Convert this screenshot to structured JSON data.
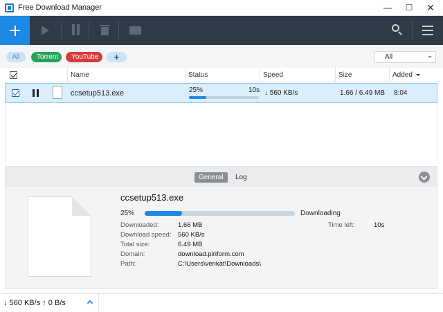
{
  "window": {
    "title": "Free Download Manager",
    "minimize": "—",
    "maximize": "☐",
    "close": "✕"
  },
  "toolbar": {
    "icons": [
      "add-icon",
      "play-icon",
      "pause-icon",
      "trash-icon",
      "move-icon",
      "search-icon",
      "menu-icon"
    ]
  },
  "filters": {
    "chips": [
      "All",
      "Torrent",
      "YouTube",
      "+"
    ],
    "select_value": "All"
  },
  "table": {
    "columns": [
      "Name",
      "Status",
      "Speed",
      "Size",
      "Added"
    ],
    "rows": [
      {
        "name": "ccsetup513.exe",
        "percent": "25%",
        "progress": 0.25,
        "eta": "10s",
        "speed": "↓ 560 KB/s",
        "size": "1.66 / 6.49 MB",
        "added": "8:04"
      }
    ]
  },
  "details": {
    "tabs": [
      "General",
      "Log"
    ],
    "file_name": "ccsetup513.exe",
    "percent": "25%",
    "progress": 0.25,
    "state": "Downloading",
    "fields": [
      {
        "label": "Downloaded:",
        "value": "1.66 MB"
      },
      {
        "label": "Download speed:",
        "value": "560 KB/s"
      },
      {
        "label": "Total size:",
        "value": "6.49 MB"
      },
      {
        "label": "Domain:",
        "value": "download.piriform.com"
      },
      {
        "label": "Path:",
        "value": "C:\\Users\\venkat\\Downloads\\"
      }
    ],
    "time_left_label": "Time left:",
    "time_left_value": "10s"
  },
  "statusbar": {
    "text": "↓ 560 KB/s  ↑ 0 B/s"
  },
  "colors": {
    "accent": "#1e88e5",
    "toolbar": "#2f3a46",
    "torrent": "#26a35a",
    "youtube": "#d93b3b"
  }
}
